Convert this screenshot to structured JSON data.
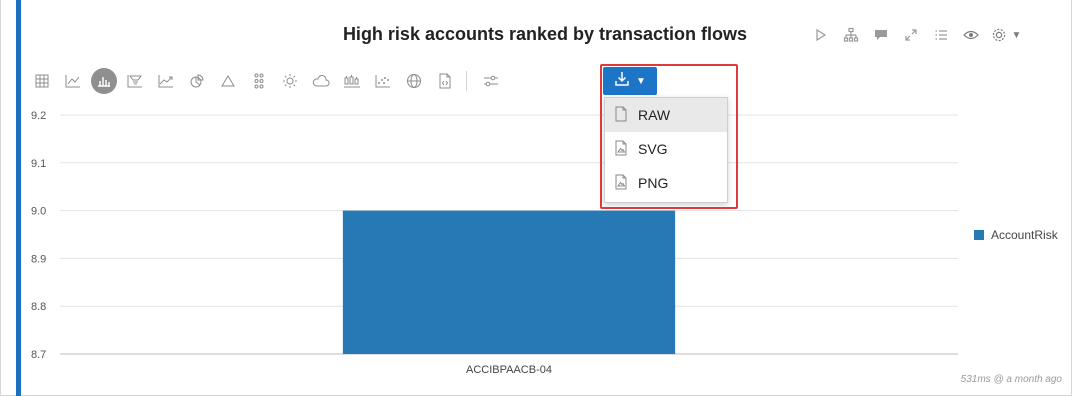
{
  "panel": {
    "title": "High risk accounts ranked by transaction flows",
    "accent_color": "#1a6fbf",
    "timing": "531ms @ a month ago"
  },
  "top_actions": [
    "run-icon",
    "hierarchy-icon",
    "comment-icon",
    "expand-icon",
    "list-icon",
    "eye-icon",
    "settings-icon"
  ],
  "toolbar": {
    "items": [
      "table-icon",
      "line-chart-icon",
      "bar-chart-icon",
      "funnel-icon",
      "area-chart-icon",
      "pie-chart-icon",
      "triangle-icon",
      "dots-grid-icon",
      "sun-icon",
      "cloud-icon",
      "boxplot-icon",
      "scatter-icon",
      "globe-icon",
      "code-file-icon",
      "sliders-icon"
    ],
    "active": "bar-chart-icon"
  },
  "download": {
    "icon": "download-icon",
    "button_color": "#1c75c7",
    "menu": [
      {
        "label": "RAW",
        "icon": "file-icon"
      },
      {
        "label": "SVG",
        "icon": "image-file-icon"
      },
      {
        "label": "PNG",
        "icon": "image-file-icon"
      }
    ],
    "highlight_color": "#dd3b3b"
  },
  "chart_data": {
    "type": "bar",
    "categories": [
      "ACCIBPAACB-04"
    ],
    "series": [
      {
        "name": "AccountRisk",
        "values": [
          9.0
        ],
        "color": "#2679b4"
      }
    ],
    "ylim": [
      8.7,
      9.2
    ],
    "yticks": [
      "9.2",
      "9.1",
      "9.0",
      "8.9",
      "8.8",
      "8.7"
    ],
    "grid": true,
    "legend": "right"
  }
}
